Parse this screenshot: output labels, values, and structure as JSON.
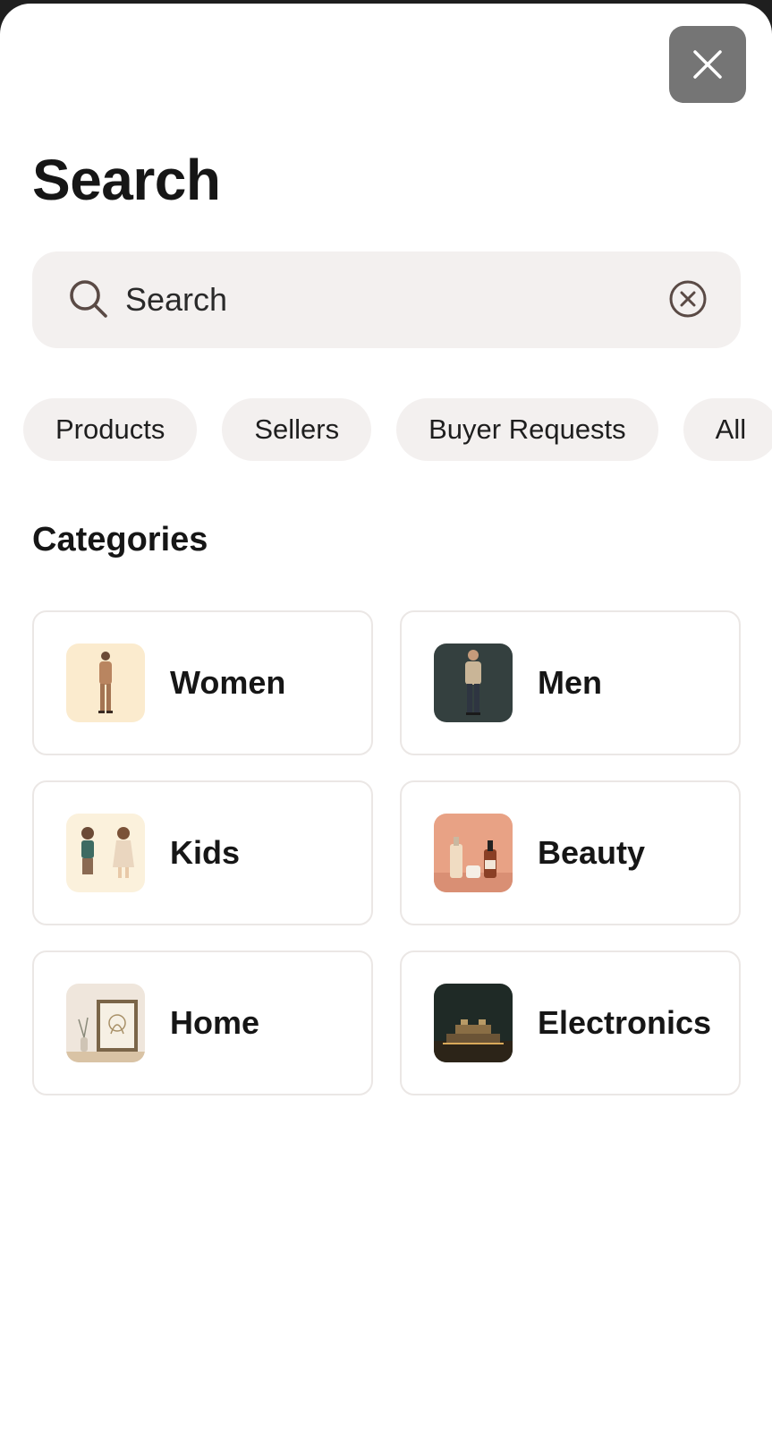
{
  "header": {
    "title": "Search",
    "close_icon": "close-icon"
  },
  "search": {
    "placeholder": "Search",
    "value": "",
    "icon": "search-icon",
    "clear_icon": "clear-circle-x-icon"
  },
  "filters": [
    "Products",
    "Sellers",
    "Buyer Requests",
    "All"
  ],
  "categories_section": {
    "title": "Categories",
    "items": [
      {
        "label": "Women",
        "thumb": "women-fashion-thumbnail"
      },
      {
        "label": "Men",
        "thumb": "men-fashion-thumbnail"
      },
      {
        "label": "Kids",
        "thumb": "kids-fashion-thumbnail"
      },
      {
        "label": "Beauty",
        "thumb": "beauty-products-thumbnail"
      },
      {
        "label": "Home",
        "thumb": "home-decor-thumbnail"
      },
      {
        "label": "Electronics",
        "thumb": "electronics-thumbnail"
      }
    ]
  },
  "colors": {
    "close_button_bg": "#757575",
    "field_bg": "#f3f0ef",
    "card_border": "#ebe7e5",
    "text": "#161616"
  }
}
